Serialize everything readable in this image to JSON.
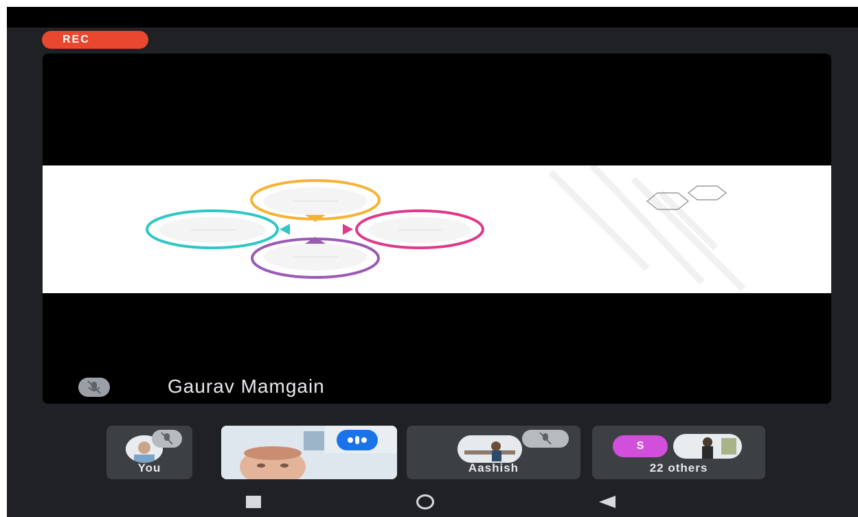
{
  "recording": {
    "badge_label": "REC"
  },
  "stage": {
    "speaker_name": "Gaurav Mamgain"
  },
  "participants": [
    {
      "label": "You"
    },
    {
      "label": ""
    },
    {
      "label": "Aashish"
    },
    {
      "label": "22 others",
      "avatar_letter": "S"
    }
  ],
  "colors": {
    "background": "#202124",
    "tile": "#3c4043",
    "rec": "#e8482f",
    "others_avatar": "#d24fdc",
    "active_speaker": "#1a73e8"
  }
}
